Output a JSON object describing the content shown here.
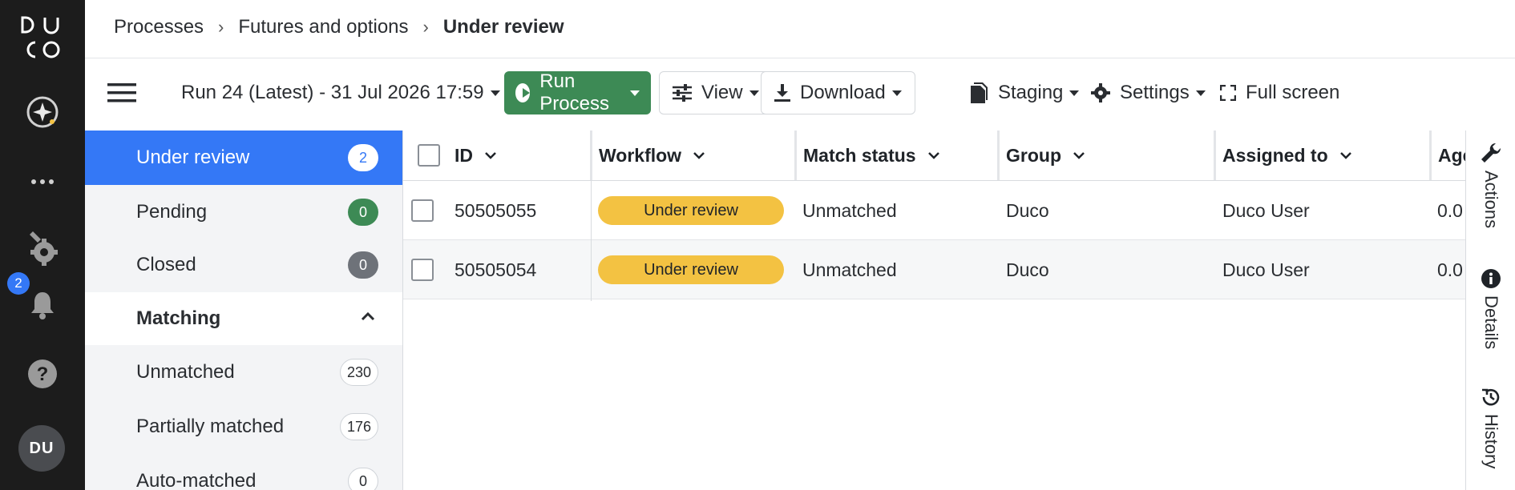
{
  "app": {
    "logo_text": "DUCO",
    "notification_count": "2",
    "user_initials": "DU",
    "rail_icons": [
      "ai-assistant-icon",
      "more-icon",
      "settings-icon",
      "bell-icon",
      "help-icon"
    ]
  },
  "breadcrumb": {
    "items": [
      "Processes",
      "Futures and options"
    ],
    "current": "Under review"
  },
  "toolbar": {
    "run_select": "Run 24 (Latest) - 31 Jul 2026 17:59",
    "run_process": "Run Process",
    "view": "View",
    "download": "Download",
    "staging": "Staging",
    "settings": "Settings",
    "fullscreen": "Full screen"
  },
  "status_panel": {
    "items": [
      {
        "label": "Under review",
        "count": "2"
      },
      {
        "label": "Pending",
        "count": "0"
      },
      {
        "label": "Closed",
        "count": "0"
      }
    ],
    "section": "Matching",
    "sub_items": [
      {
        "label": "Unmatched",
        "count": "230"
      },
      {
        "label": "Partially matched",
        "count": "176"
      },
      {
        "label": "Auto-matched",
        "count": "0"
      }
    ]
  },
  "grid": {
    "columns": [
      "ID",
      "Workflow",
      "Match status",
      "Group",
      "Assigned to",
      "Age"
    ],
    "rows": [
      {
        "id": "50505055",
        "workflow": "Under review",
        "match_status": "Unmatched",
        "group": "Duco",
        "assigned_to": "Duco User",
        "age": "0.0"
      },
      {
        "id": "50505054",
        "workflow": "Under review",
        "match_status": "Unmatched",
        "group": "Duco",
        "assigned_to": "Duco User",
        "age": "0.0"
      }
    ]
  },
  "right_rail": {
    "actions": "Actions",
    "details": "Details",
    "history": "History"
  },
  "colors": {
    "rail_bg": "#1c1c1c",
    "accent_blue": "#3478f6",
    "run_green": "#3d8a55",
    "pill_yellow": "#f3c242",
    "link_blue": "#2f6fe0"
  }
}
